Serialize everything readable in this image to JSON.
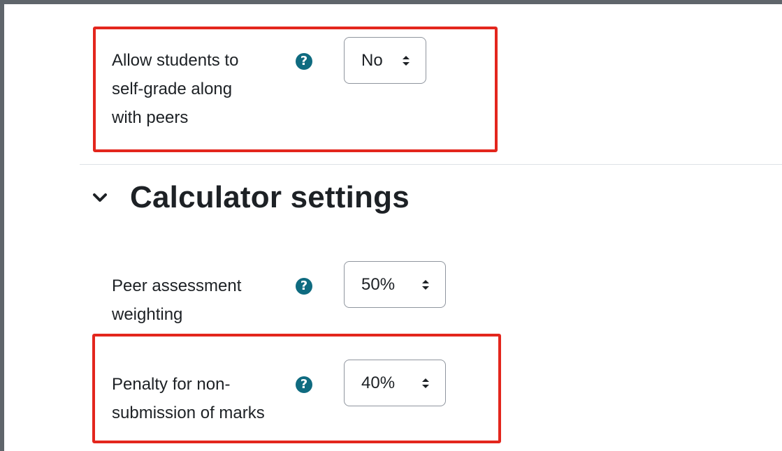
{
  "settings": {
    "self_grade": {
      "label": "Allow students to\nself-grade along\nwith peers",
      "value": "No"
    },
    "section": {
      "title": "Calculator settings"
    },
    "peer_weighting": {
      "label": "Peer assessment\nweighting",
      "value": "50%"
    },
    "penalty": {
      "label": "Penalty for non-\nsubmission of marks",
      "value": "40%"
    }
  },
  "icons": {
    "help": "question-circle-icon",
    "select_caret": "sort-caret-icon",
    "collapse": "chevron-down-icon"
  },
  "colors": {
    "help_icon": "#0f6b80",
    "highlight_border": "#e3261d",
    "text": "#1d2125",
    "frame": "#5f656b"
  }
}
